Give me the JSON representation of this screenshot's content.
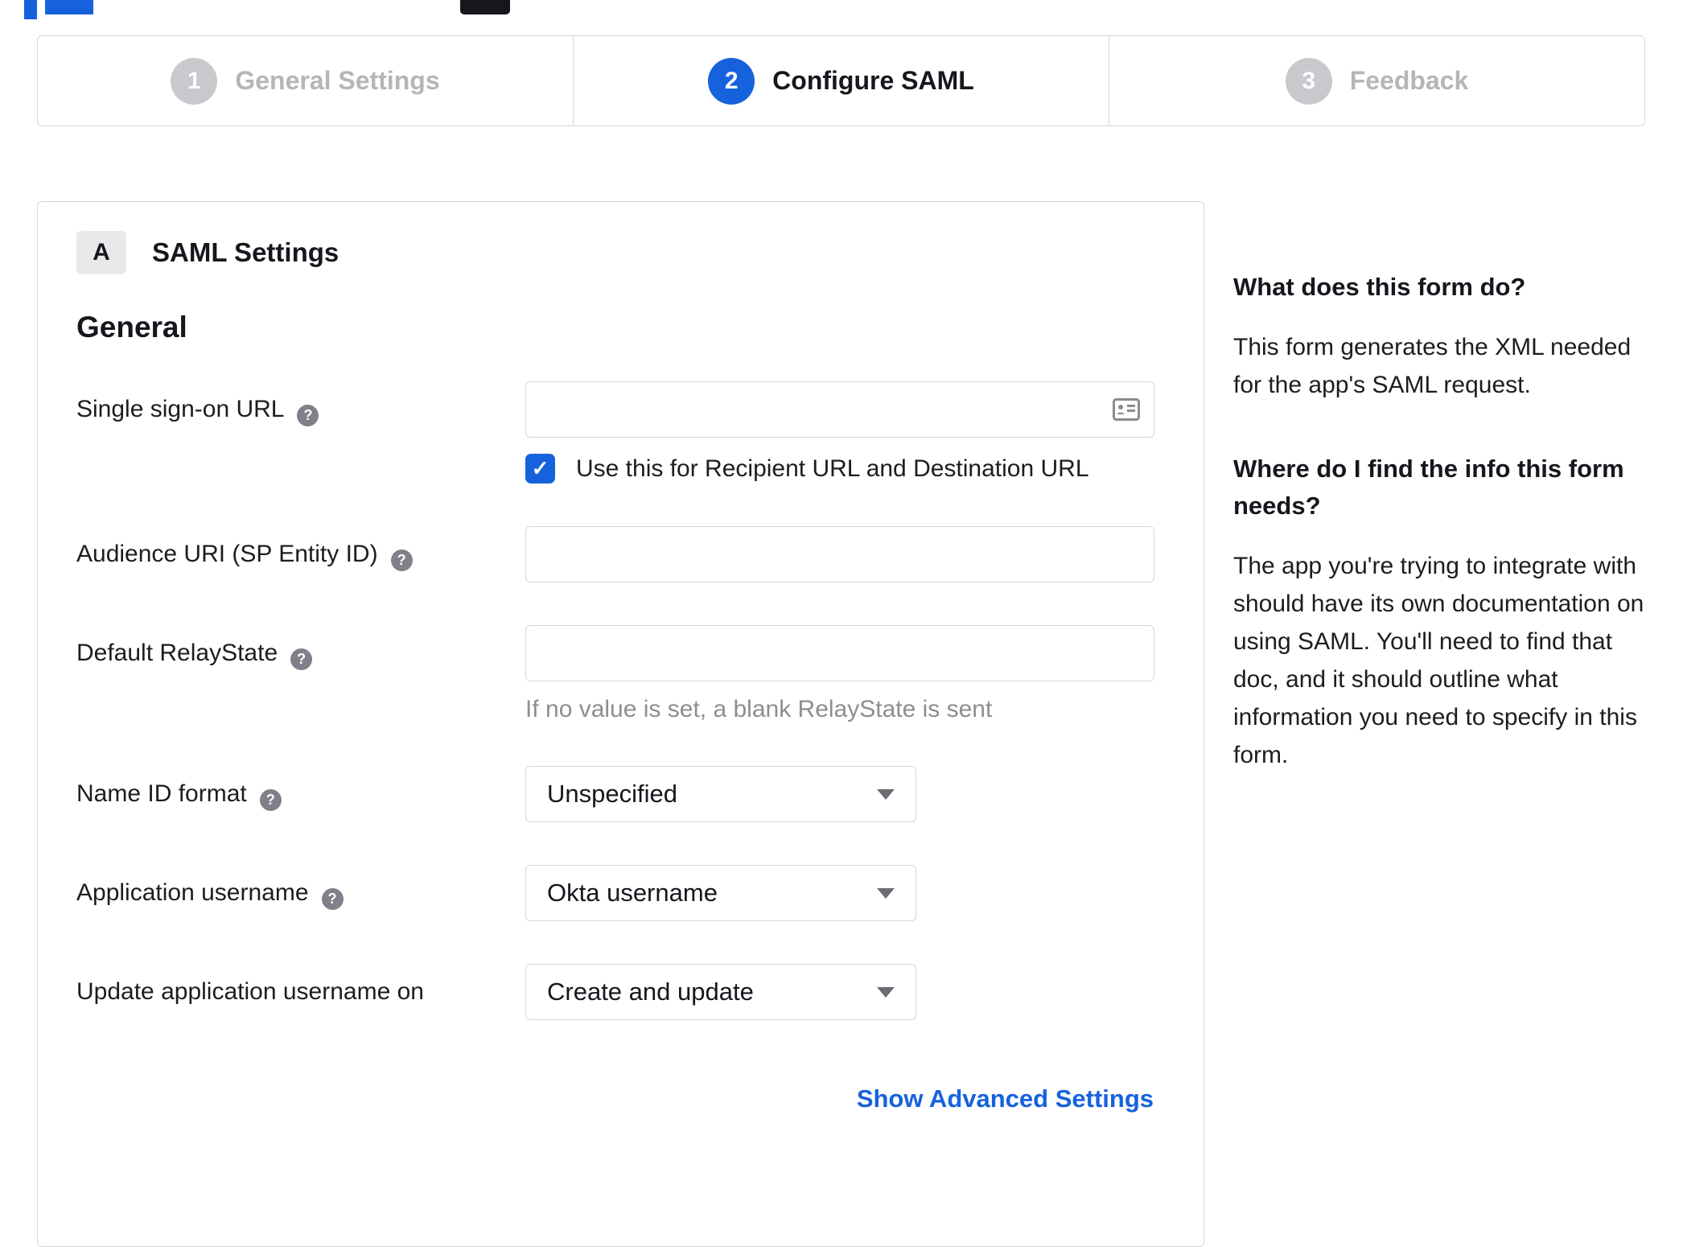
{
  "stepper": {
    "steps": [
      {
        "number": "1",
        "label": "General Settings",
        "state": "inactive"
      },
      {
        "number": "2",
        "label": "Configure SAML",
        "state": "active"
      },
      {
        "number": "3",
        "label": "Feedback",
        "state": "inactive"
      }
    ]
  },
  "panel": {
    "badge": "A",
    "title": "SAML Settings",
    "group": "General",
    "sso": {
      "label": "Single sign-on URL",
      "value": "",
      "checkbox_label": "Use this for Recipient URL and Destination URL",
      "checkbox_checked": true
    },
    "audience": {
      "label": "Audience URI (SP Entity ID)",
      "value": ""
    },
    "relaystate": {
      "label": "Default RelayState",
      "value": "",
      "helper": "If no value is set, a blank RelayState is sent"
    },
    "nameid": {
      "label": "Name ID format",
      "value": "Unspecified"
    },
    "appusername": {
      "label": "Application username",
      "value": "Okta username"
    },
    "updateusername": {
      "label": "Update application username on",
      "value": "Create and update"
    },
    "advanced_link": "Show Advanced Settings"
  },
  "sidebar": {
    "q1_title": "What does this form do?",
    "q1_body": "This form generates the XML needed for the app's SAML request.",
    "q2_title": "Where do I find the info this form needs?",
    "q2_body": "The app you're trying to integrate with should have its own documentation on using SAML. You'll need to find that doc, and it should outline what information you need to specify in this form."
  },
  "icons": {
    "help": "?",
    "check": "✓",
    "card": "contact-card-icon",
    "chevron": "chevron-down-icon"
  },
  "colors": {
    "accent": "#1662dd",
    "link": "#1662dd",
    "border": "#d7d7dc",
    "inactive_step": "#c9c9cd",
    "helper_text": "#8d8d93"
  }
}
